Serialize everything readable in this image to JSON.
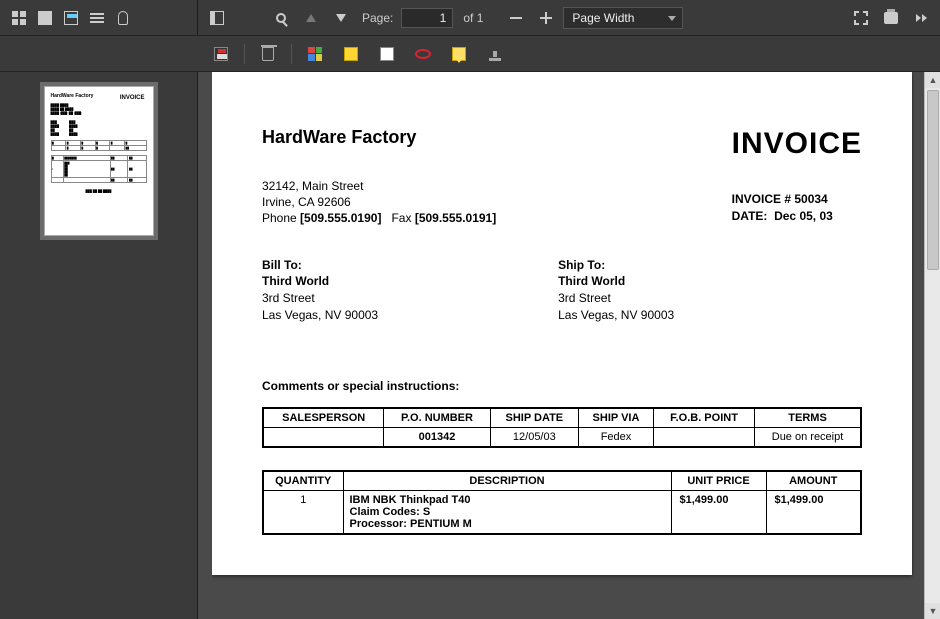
{
  "toolbar": {
    "page_label": "Page:",
    "page_current": "1",
    "page_total_prefix": "of",
    "page_total": "1",
    "zoom_mode": "Page Width"
  },
  "doc": {
    "company": "HardWare Factory",
    "title": "INVOICE",
    "address_line1": "32142, Main Street",
    "address_line2": "Irvine, CA 92606",
    "phone_label": "Phone",
    "phone": "[509.555.0190]",
    "fax_label": "Fax",
    "fax": "[509.555.0191]",
    "invoice_no_label": "INVOICE #",
    "invoice_no": "50034",
    "date_label": "DATE:",
    "date": "Dec 05, 03",
    "bill_to_label": "Bill To:",
    "ship_to_label": "Ship To:",
    "party": {
      "name": "Third World",
      "addr1": "3rd Street",
      "addr2": "Las Vegas, NV 90003"
    },
    "comments_label": "Comments or special instructions:",
    "header_tbl": {
      "cols": [
        "SALESPERSON",
        "P.O. NUMBER",
        "SHIP DATE",
        "SHIP VIA",
        "F.O.B. POINT",
        "TERMS"
      ],
      "row": [
        "",
        "001342",
        "12/05/03",
        "Fedex",
        "",
        "Due on receipt"
      ]
    },
    "items_tbl": {
      "cols": [
        "QUANTITY",
        "DESCRIPTION",
        "UNIT PRICE",
        "AMOUNT"
      ],
      "rows": [
        {
          "qty": "1",
          "desc_lines": [
            "IBM NBK Thinkpad T40",
            "Claim Codes: S",
            "Processor: PENTIUM M"
          ],
          "unit": "$1,499.00",
          "amount": "$1,499.00"
        }
      ]
    }
  },
  "chart_data": {
    "type": "table",
    "title": "Invoice 50034 — HardWare Factory",
    "header_info": {
      "SALESPERSON": "",
      "P.O. NUMBER": "001342",
      "SHIP DATE": "12/05/03",
      "SHIP VIA": "Fedex",
      "F.O.B. POINT": "",
      "TERMS": "Due on receipt"
    },
    "line_items": {
      "columns": [
        "QUANTITY",
        "DESCRIPTION",
        "UNIT PRICE",
        "AMOUNT"
      ],
      "rows": [
        [
          1,
          "IBM NBK Thinkpad T40; Claim Codes: S; Processor: PENTIUM M",
          1499.0,
          1499.0
        ]
      ]
    }
  }
}
